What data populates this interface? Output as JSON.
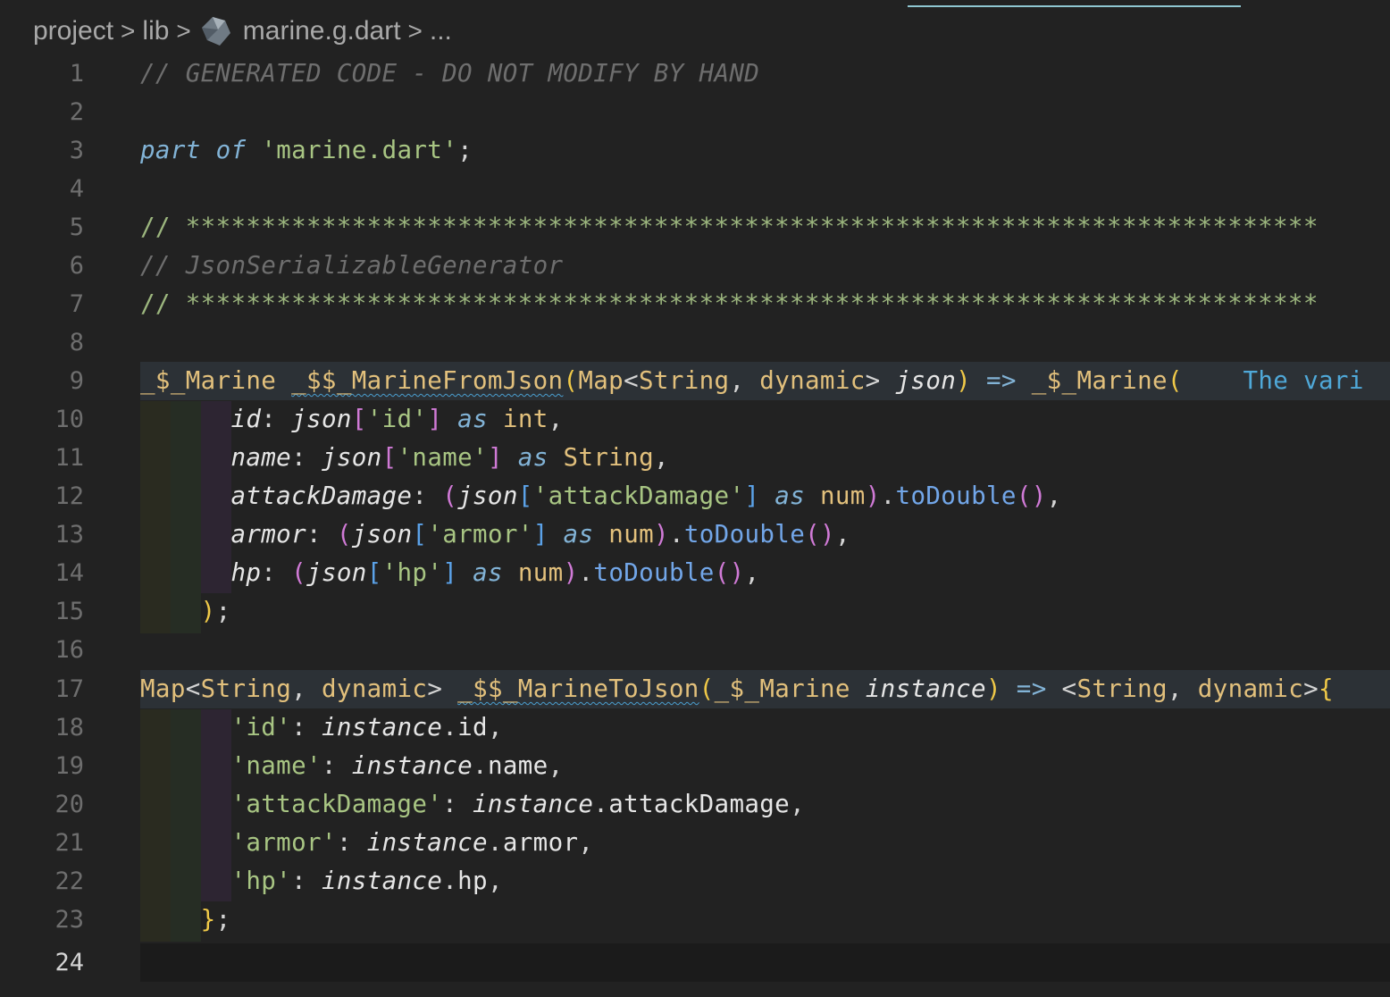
{
  "breadcrumb": {
    "parts": [
      "project",
      "lib",
      "marine.g.dart",
      "..."
    ],
    "separator": ">",
    "file_icon": "dart-icon"
  },
  "editor": {
    "active_line": 24,
    "line_numbers": [
      "1",
      "2",
      "3",
      "4",
      "5",
      "6",
      "7",
      "8",
      "9",
      "10",
      "11",
      "12",
      "13",
      "14",
      "15",
      "16",
      "17",
      "18",
      "19",
      "20",
      "21",
      "22",
      "23",
      "24"
    ],
    "hover_hint": "The vari",
    "lines": {
      "l1": {
        "comment": "// GENERATED CODE - DO NOT MODIFY BY HAND"
      },
      "l3": {
        "part": "part",
        "of": "of",
        "file": "'marine.dart'",
        "semi": ";"
      },
      "l5": {
        "slashes": "//",
        "stars": "***************************************************************************"
      },
      "l6": {
        "comment": "// JsonSerializableGenerator"
      },
      "l7": {
        "slashes": "//",
        "stars": "***************************************************************************"
      },
      "l9": {
        "ret": "_$_Marine",
        "fn": "_$$_MarineFromJson",
        "open": "(",
        "map": "Map",
        "lt": "<",
        "string": "String",
        "comma": ",",
        "dynamic": "dynamic",
        "gt": ">",
        "param": "json",
        "close": ")",
        "arrow": "=>",
        "ctor": "_$_Marine",
        "ctor_open": "("
      },
      "l10": {
        "key": "id",
        "colon": ":",
        "json": "json",
        "lb": "[",
        "str": "'id'",
        "rb": "]",
        "as": "as",
        "type": "int",
        "comma": ","
      },
      "l11": {
        "key": "name",
        "colon": ":",
        "json": "json",
        "lb": "[",
        "str": "'name'",
        "rb": "]",
        "as": "as",
        "type": "String",
        "comma": ","
      },
      "l12": {
        "key": "attackDamage",
        "colon": ":",
        "po": "(",
        "json": "json",
        "lb": "[",
        "str": "'attackDamage'",
        "rb": "]",
        "as": "as",
        "type": "num",
        "pc": ")",
        "dot": ".",
        "method": "toDouble",
        "co": "(",
        "cc": ")",
        "comma": ","
      },
      "l13": {
        "key": "armor",
        "colon": ":",
        "po": "(",
        "json": "json",
        "lb": "[",
        "str": "'armor'",
        "rb": "]",
        "as": "as",
        "type": "num",
        "pc": ")",
        "dot": ".",
        "method": "toDouble",
        "co": "(",
        "cc": ")",
        "comma": ","
      },
      "l14": {
        "key": "hp",
        "colon": ":",
        "po": "(",
        "json": "json",
        "lb": "[",
        "str": "'hp'",
        "rb": "]",
        "as": "as",
        "type": "num",
        "pc": ")",
        "dot": ".",
        "method": "toDouble",
        "co": "(",
        "cc": ")",
        "comma": ","
      },
      "l15": {
        "close": ")",
        "semi": ";"
      },
      "l17": {
        "map": "Map",
        "lt": "<",
        "string": "String",
        "comma": ",",
        "dynamic": "dynamic",
        "gt": ">",
        "fn": "_$$_MarineToJson",
        "open": "(",
        "type": "_$_Marine",
        "param": "instance",
        "close": ")",
        "arrow": "=>",
        "lit_lt": "<",
        "lit_string": "String",
        "lit_comma": ",",
        "lit_dynamic": "dynamic",
        "lit_gt": ">",
        "brace": "{"
      },
      "l18": {
        "key": "'id'",
        "colon": ":",
        "obj": "instance",
        "dot": ".",
        "prop": "id",
        "comma": ","
      },
      "l19": {
        "key": "'name'",
        "colon": ":",
        "obj": "instance",
        "dot": ".",
        "prop": "name",
        "comma": ","
      },
      "l20": {
        "key": "'attackDamage'",
        "colon": ":",
        "obj": "instance",
        "dot": ".",
        "prop": "attackDamage",
        "comma": ","
      },
      "l21": {
        "key": "'armor'",
        "colon": ":",
        "obj": "instance",
        "dot": ".",
        "prop": "armor",
        "comma": ","
      },
      "l22": {
        "key": "'hp'",
        "colon": ":",
        "obj": "instance",
        "dot": ".",
        "prop": "hp",
        "comma": ","
      },
      "l23": {
        "close": "}",
        "semi": ";"
      }
    }
  },
  "colors": {
    "background": "#222222",
    "comment": "#6e6e6e",
    "keyword": "#82b3d6",
    "string": "#a8c583",
    "type": "#e2c07c",
    "function": "#72a6e8",
    "bracket_pink": "#d07ad6",
    "bracket_blue": "#5ba2e8",
    "bracket_yellow": "#f0c948"
  }
}
